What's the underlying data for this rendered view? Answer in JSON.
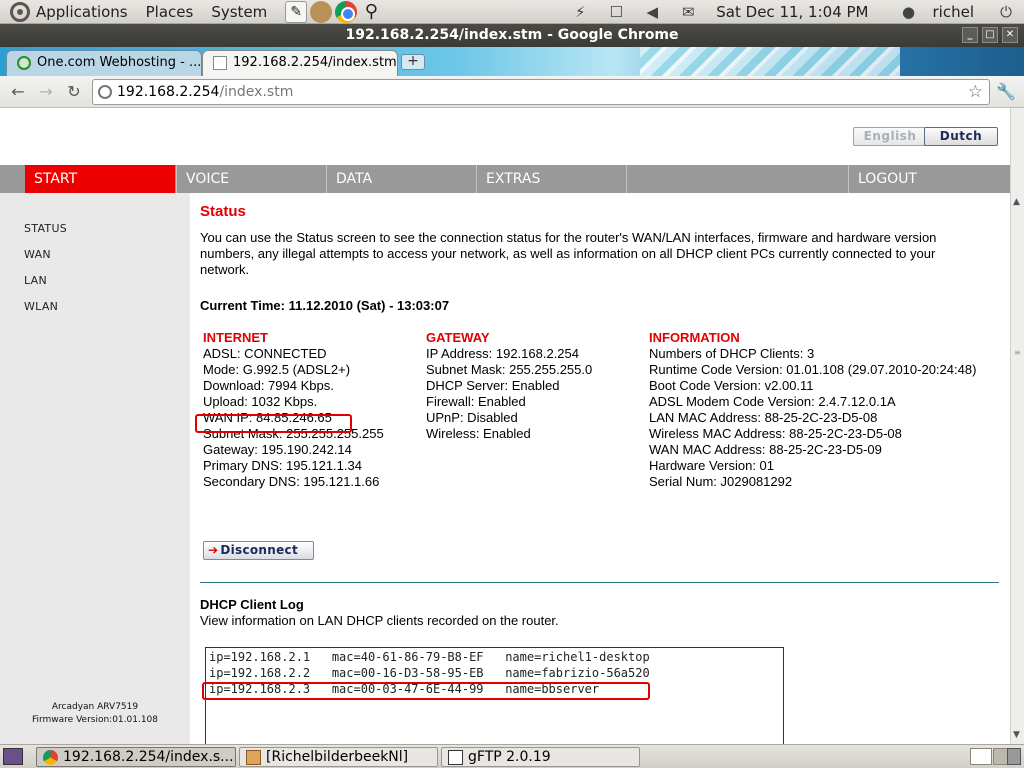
{
  "top_panel": {
    "menus": [
      "Applications",
      "Places",
      "System"
    ],
    "clock": "Sat Dec 11,  1:04 PM",
    "user": "richel"
  },
  "window": {
    "title": "192.168.2.254/index.stm - Google Chrome"
  },
  "tabs": [
    {
      "label": "One.com Webhosting - ...",
      "active": false
    },
    {
      "label": "192.168.2.254/index.stm",
      "active": true
    }
  ],
  "omnibox": {
    "host": "192.168.2.254",
    "path": "/index.stm"
  },
  "page": {
    "languages": {
      "english": "English",
      "dutch": "Dutch"
    },
    "nav": [
      "START",
      "VOICE",
      "DATA",
      "EXTRAS",
      "",
      "LOGOUT"
    ],
    "sidebar": [
      "STATUS",
      "WAN",
      "LAN",
      "WLAN"
    ],
    "device": {
      "model": "Arcadyan ARV7519",
      "firmware": "Firmware Version:01.01.108"
    },
    "title": "Status",
    "intro": "You can use the Status screen to see the connection status for the router's WAN/LAN interfaces, firmware and hardware version numbers, any illegal attempts to access your network, as well as information on all DHCP client PCs currently connected to your network.",
    "current_time": "Current Time: 11.12.2010 (Sat) - 13:03:07",
    "internet": {
      "heading": "INTERNET",
      "rows": [
        "ADSL:  CONNECTED",
        "Mode:  G.992.5 (ADSL2+)",
        "Download:  7994 Kbps.",
        "Upload:  1032 Kbps.",
        "WAN IP:  84.85.246.65",
        "Subnet Mask:  255.255.255.255",
        "Gateway:  195.190.242.14",
        "Primary DNS:  195.121.1.34",
        "Secondary DNS:  195.121.1.66"
      ]
    },
    "gateway": {
      "heading": "GATEWAY",
      "rows": [
        "IP Address:  192.168.2.254",
        "Subnet Mask:  255.255.255.0",
        "DHCP Server:  Enabled",
        "Firewall:  Enabled",
        "UPnP:  Disabled",
        "Wireless:  Enabled"
      ]
    },
    "information": {
      "heading": "INFORMATION",
      "rows": [
        "Numbers of DHCP Clients:  3",
        "Runtime Code Version:  01.01.108 (29.07.2010-20:24:48)",
        "Boot Code Version:  v2.00.11",
        "ADSL Modem Code Version: 2.4.7.12.0.1A",
        "LAN MAC Address: 88-25-2C-23-D5-08",
        "Wireless MAC Address: 88-25-2C-23-D5-08",
        "WAN MAC Address: 88-25-2C-23-D5-09",
        "Hardware Version:  01",
        "Serial Num:   J029081292"
      ]
    },
    "disconnect_label": "Disconnect",
    "dhcp_log": {
      "title": "DHCP Client Log",
      "description": "View information on LAN DHCP clients recorded on the router.",
      "rows": [
        "ip=192.168.2.1   mac=40-61-86-79-B8-EF   name=richel1-desktop",
        "ip=192.168.2.2   mac=00-16-D3-58-95-EB   name=fabrizio-56a520",
        "ip=192.168.2.3   mac=00-03-47-6E-44-99   name=bbserver"
      ]
    }
  },
  "taskbar": [
    {
      "label": "192.168.2.254/index.s...",
      "icon": "chrome-icon",
      "active": true
    },
    {
      "label": "[RichelbilderbeekNl]",
      "icon": "folder-icon",
      "active": false
    },
    {
      "label": "gFTP 2.0.19",
      "icon": "gftp-icon",
      "active": false
    }
  ],
  "colors": {
    "accent_red": "#ee0000",
    "nav_gray": "#999999",
    "sidebar_gray": "#e9e9e9"
  }
}
